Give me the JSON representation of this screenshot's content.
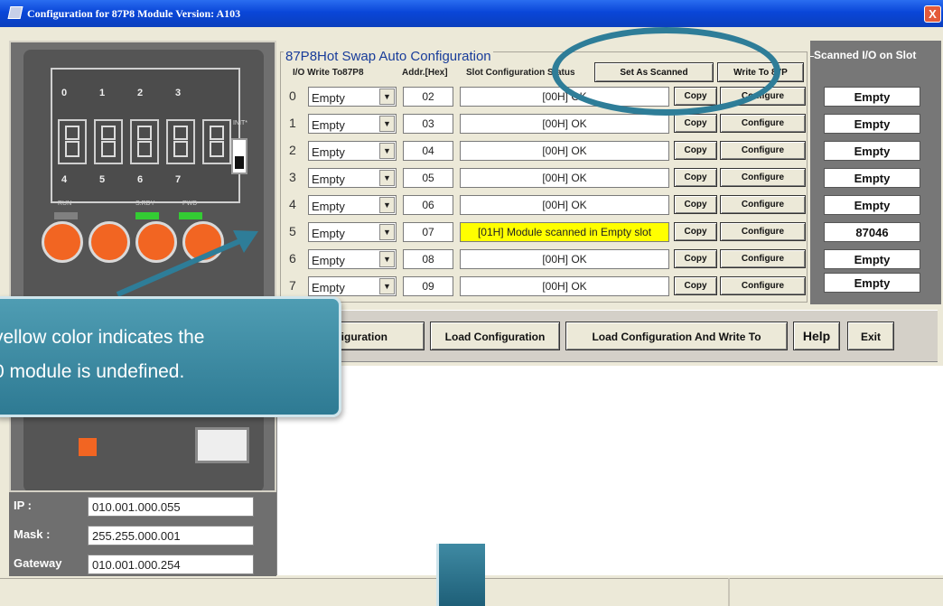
{
  "window": {
    "title": "Configuration for 87P8 Module Version: A103",
    "close_label": "X"
  },
  "module_panel": {
    "digit_labels_top": [
      "0",
      "1",
      "2",
      "3"
    ],
    "digit_labels_bottom": [
      "4",
      "5",
      "6",
      "7"
    ],
    "init_label": "INIT*",
    "leds": [
      {
        "label": "RUN",
        "color": "#808080"
      },
      {
        "label": "S.RDY",
        "color": "#33cc33"
      },
      {
        "label": "PWD",
        "color": "#33cc33"
      }
    ]
  },
  "network": {
    "ip_label": "IP :",
    "ip_value": "010.001.000.055",
    "mask_label": "Mask :",
    "mask_value": "255.255.000.001",
    "gateway_label": "Gateway",
    "gateway_value": "010.001.000.254"
  },
  "config_group": {
    "title": "87P8Hot Swap Auto Configuration",
    "col_io": "I/O Write To87P8",
    "col_addr": "Addr.[Hex]",
    "col_status": "Slot Configuration Status",
    "set_scanned_label": "Set As Scanned",
    "write_to_label": "Write To 87P",
    "copy_label": "Copy",
    "configure_label": "Configure",
    "rows": [
      {
        "index": "0",
        "module": "Empty",
        "addr": "02",
        "status": "[00H] OK",
        "warning": false
      },
      {
        "index": "1",
        "module": "Empty",
        "addr": "03",
        "status": "[00H] OK",
        "warning": false
      },
      {
        "index": "2",
        "module": "Empty",
        "addr": "04",
        "status": "[00H] OK",
        "warning": false
      },
      {
        "index": "3",
        "module": "Empty",
        "addr": "05",
        "status": "[00H] OK",
        "warning": false
      },
      {
        "index": "4",
        "module": "Empty",
        "addr": "06",
        "status": "[00H] OK",
        "warning": false
      },
      {
        "index": "5",
        "module": "Empty",
        "addr": "07",
        "status": "[01H] Module scanned in Empty slot",
        "warning": true
      },
      {
        "index": "6",
        "module": "Empty",
        "addr": "08",
        "status": "[00H] OK",
        "warning": false
      },
      {
        "index": "7",
        "module": "Empty",
        "addr": "09",
        "status": "[00H] OK",
        "warning": false
      }
    ]
  },
  "scanned_panel": {
    "title": "Scanned I/O on Slot",
    "values": [
      "Empty",
      "Empty",
      "Empty",
      "Empty",
      "Empty",
      "87046",
      "Empty",
      "Empty"
    ]
  },
  "bottom_buttons": {
    "save": "onfiguration",
    "load": "Load Configuration",
    "load_write": "Load  Configuration And Write To",
    "help": "Help",
    "exit": "Exit"
  },
  "callout": {
    "text": "yellow color indicates the\n0 module is undefined."
  },
  "colors": {
    "accent": "#2e7d98",
    "warning": "#ffff00",
    "knob": "#f26522"
  }
}
